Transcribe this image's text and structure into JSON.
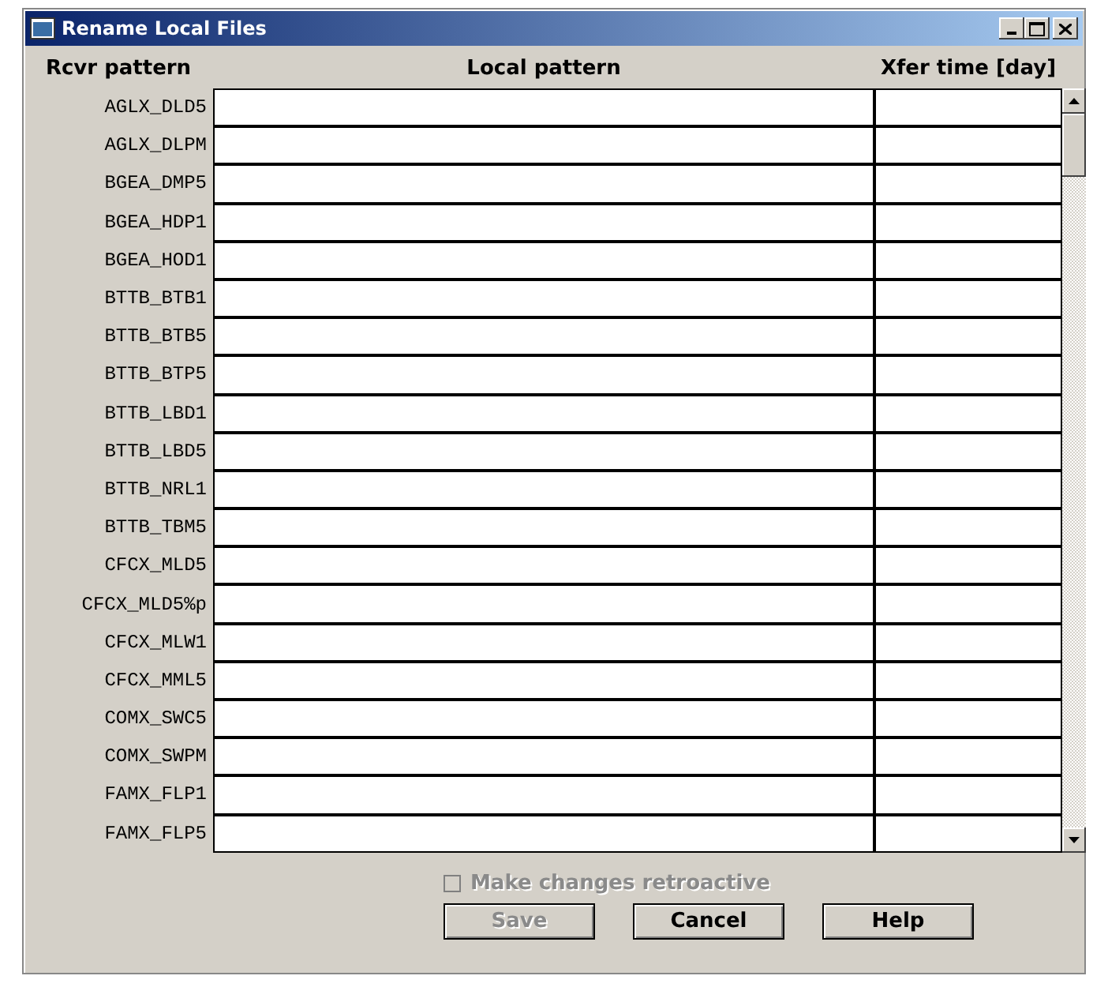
{
  "window": {
    "title": "Rename Local Files"
  },
  "columns": [
    "Rcvr pattern",
    "Local pattern",
    "Xfer time [day]"
  ],
  "rows": [
    {
      "rcvr": "AGLX_DLD5"
    },
    {
      "rcvr": "AGLX_DLPM"
    },
    {
      "rcvr": "BGEA_DMP5"
    },
    {
      "rcvr": "BGEA_HDP1"
    },
    {
      "rcvr": "BGEA_HOD1"
    },
    {
      "rcvr": "BTTB_BTB1"
    },
    {
      "rcvr": "BTTB_BTB5"
    },
    {
      "rcvr": "BTTB_BTP5"
    },
    {
      "rcvr": "BTTB_LBD1"
    },
    {
      "rcvr": "BTTB_LBD5"
    },
    {
      "rcvr": "BTTB_NRL1"
    },
    {
      "rcvr": "BTTB_TBM5"
    },
    {
      "rcvr": "CFCX_MLD5"
    },
    {
      "rcvr": "CFCX_MLD5%p"
    },
    {
      "rcvr": "CFCX_MLW1"
    },
    {
      "rcvr": "CFCX_MML5"
    },
    {
      "rcvr": "COMX_SWC5"
    },
    {
      "rcvr": "COMX_SWPM"
    },
    {
      "rcvr": "FAMX_FLP1"
    },
    {
      "rcvr": "FAMX_FLP5"
    }
  ],
  "checkbox": {
    "label": "Make changes retroactive",
    "checked": false,
    "disabled": true
  },
  "buttons": [
    {
      "label": "Save",
      "disabled": true
    },
    {
      "label": "Cancel",
      "disabled": false
    },
    {
      "label": "Help",
      "disabled": false
    }
  ]
}
